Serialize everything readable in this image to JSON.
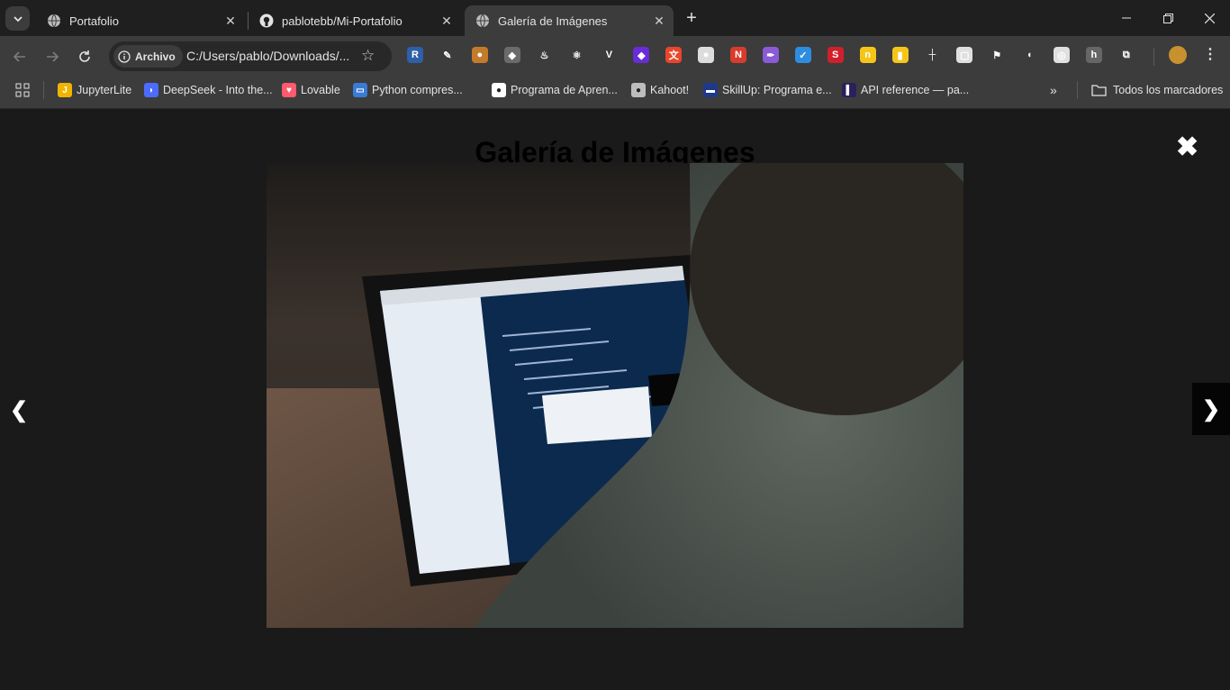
{
  "tabs": [
    {
      "title": "Portafolio",
      "icon": "globe-icon",
      "active": false
    },
    {
      "title": "pablotebb/Mi-Portafolio",
      "icon": "github-icon",
      "active": false
    },
    {
      "title": "Galería de Imágenes",
      "icon": "globe-icon",
      "active": true
    }
  ],
  "omnibox": {
    "chip_label": "Archivo",
    "url": "C:/Users/pablo/Downloads/..."
  },
  "extensions": [
    {
      "icon": "r-extension-icon",
      "color": "#2f5fa8",
      "glyph": "R"
    },
    {
      "icon": "eyedropper-icon",
      "color": "#3c3c3c",
      "glyph": "✎"
    },
    {
      "icon": "cookie-icon",
      "color": "#c47a2b",
      "glyph": "●"
    },
    {
      "icon": "shield-icon",
      "color": "#6b6b6b",
      "glyph": "◆"
    },
    {
      "icon": "java-icon",
      "color": "#3c3c3c",
      "glyph": "♨"
    },
    {
      "icon": "react-icon",
      "color": "#3c3c3c",
      "glyph": "⚛"
    },
    {
      "icon": "vue-icon",
      "color": "#3c3c3c",
      "glyph": "V"
    },
    {
      "icon": "gem-icon",
      "color": "#6a2bd8",
      "glyph": "◆"
    },
    {
      "icon": "translate-icon",
      "color": "#e8462b",
      "glyph": "文"
    },
    {
      "icon": "circle-icon",
      "color": "#dddddd",
      "glyph": "●"
    },
    {
      "icon": "new-badge-icon",
      "color": "#d83b2b",
      "glyph": "N"
    },
    {
      "icon": "feather-icon",
      "color": "#8a5ad8",
      "glyph": "✒"
    },
    {
      "icon": "v-check-icon",
      "color": "#2d8ee0",
      "glyph": "✓"
    },
    {
      "icon": "s-extension-icon",
      "color": "#d0202b",
      "glyph": "S"
    },
    {
      "icon": "note-icon",
      "color": "#f5c518",
      "glyph": "n"
    },
    {
      "icon": "bar-chart-icon",
      "color": "#f5c518",
      "glyph": "▮"
    },
    {
      "icon": "ruler-icon",
      "color": "#3c3c3c",
      "glyph": "┼"
    },
    {
      "icon": "screen-capture-icon",
      "color": "#e0e0e0",
      "glyph": "▢"
    },
    {
      "icon": "flag-icon",
      "color": "#3c3c3c",
      "glyph": "⚑"
    },
    {
      "icon": "mouse-icon",
      "color": "#3c3c3c",
      "glyph": "◖"
    },
    {
      "icon": "camera-icon",
      "color": "#e0e0e0",
      "glyph": "◎"
    },
    {
      "icon": "h-extension-icon",
      "color": "#666666",
      "glyph": "h"
    },
    {
      "icon": "puzzle-icon",
      "color": "#3c3c3c",
      "glyph": "⧉"
    }
  ],
  "bookmarks": [
    {
      "label": "JupyterLite",
      "icon": "jupyter-icon",
      "color": "#f0b400",
      "glyph": "J"
    },
    {
      "label": "DeepSeek - Into the...",
      "icon": "deepseek-icon",
      "color": "#4d6bfe",
      "glyph": "◗"
    },
    {
      "label": "Lovable",
      "icon": "heart-icon",
      "color": "#ff5a6e",
      "glyph": "♥"
    },
    {
      "label": "Python compres...",
      "icon": "python-icon",
      "color": "#3a7bd5",
      "glyph": "▭"
    },
    {
      "label": "Programa de Apren...",
      "icon": "github-icon",
      "color": "#ffffff",
      "glyph": "●"
    },
    {
      "label": "Kahoot!",
      "icon": "globe-icon",
      "color": "#bdbdbd",
      "glyph": "●"
    },
    {
      "label": "SkillUp: Programa e...",
      "icon": "skillup-icon",
      "color": "#1d3a8a",
      "glyph": "▬"
    },
    {
      "label": "API reference — pa...",
      "icon": "api-icon",
      "color": "#2b1f5e",
      "glyph": "▌"
    }
  ],
  "all_bookmarks_label": "Todos los marcadores",
  "page": {
    "heading": "Galería de Imágenes",
    "close_glyph": "✖",
    "prev_glyph": "❮",
    "next_glyph": "❯"
  }
}
